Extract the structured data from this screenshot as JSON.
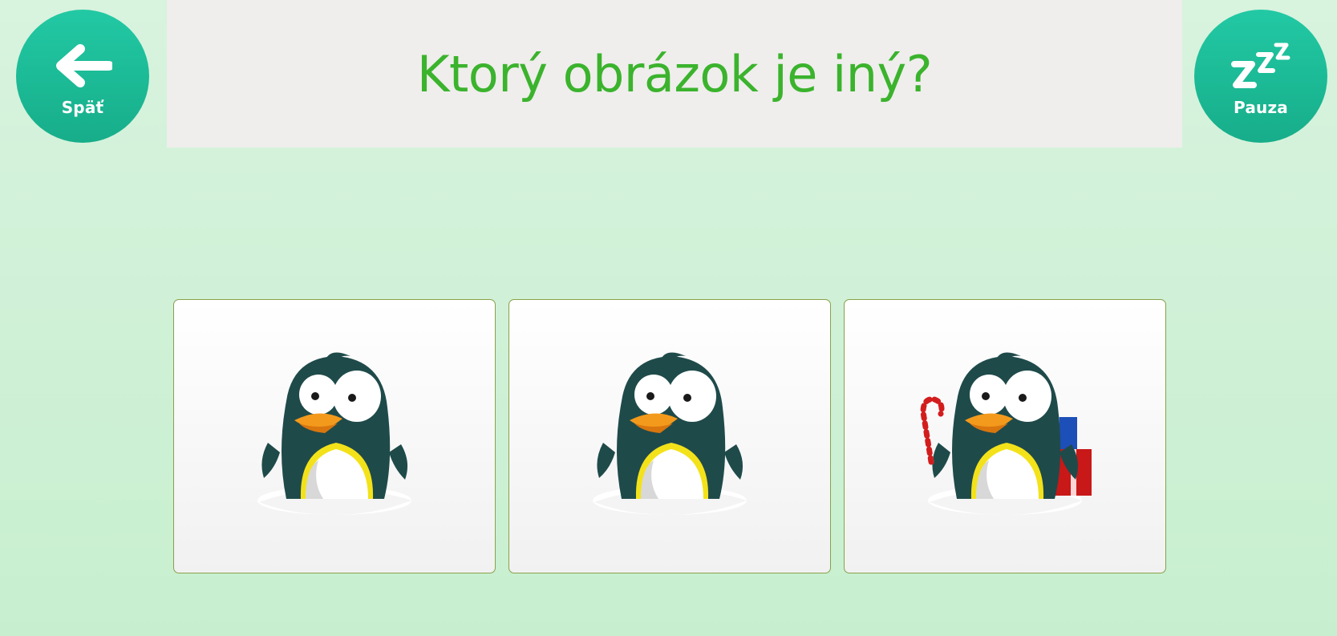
{
  "header": {
    "title": "Ktorý obrázok je iný?"
  },
  "back_button": {
    "label": "Späť",
    "icon": "arrow-left-icon"
  },
  "pause_button": {
    "label": "Pauza",
    "icon": "zzz-sleep-icon"
  },
  "colors": {
    "background": "#c9f0d1",
    "button": "#1bbf9b",
    "title": "#3bb32d",
    "banner": "#efeeec",
    "card_border": "#8aa04a"
  },
  "cards": [
    {
      "picture": "penguin",
      "accessories": []
    },
    {
      "picture": "penguin",
      "accessories": []
    },
    {
      "picture": "penguin",
      "accessories": [
        "candy-cane",
        "gift-boxes"
      ]
    }
  ]
}
